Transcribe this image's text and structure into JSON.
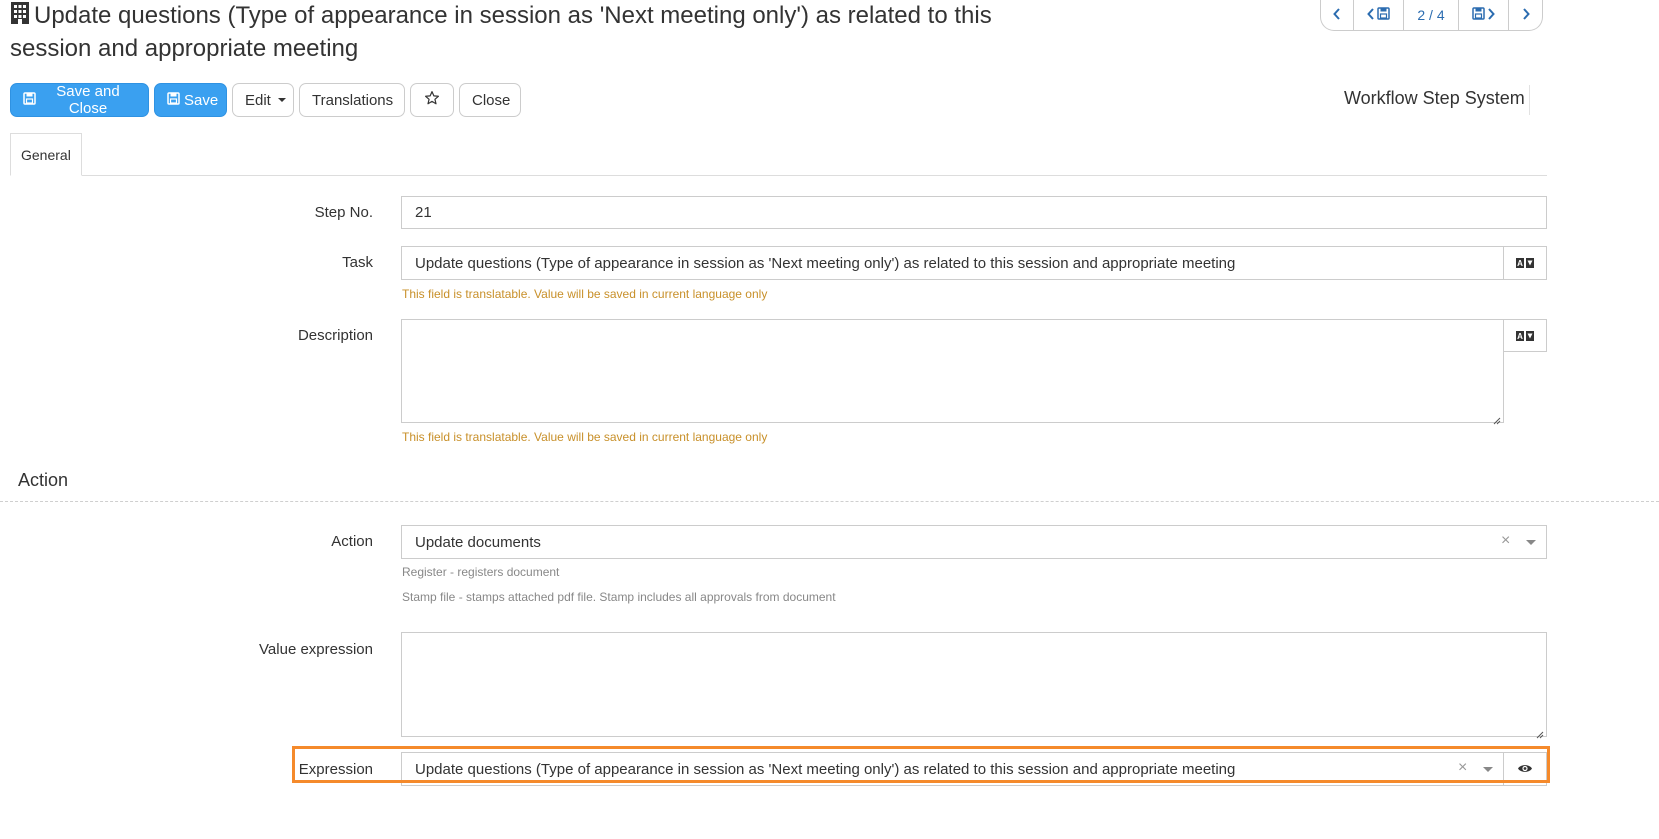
{
  "header": {
    "title": "Update questions (Type of appearance in session as 'Next meeting only') as related to this session and appropriate meeting",
    "title_icon": "building-icon"
  },
  "pager": {
    "position": "2 / 4"
  },
  "toolbar": {
    "save_close_label": "Save and Close",
    "save_label": "Save",
    "edit_label": "Edit",
    "translations_label": "Translations",
    "close_label": "Close"
  },
  "context": {
    "label": "Workflow Step System"
  },
  "tabs": [
    {
      "label": "General",
      "active": true
    }
  ],
  "form": {
    "step_no": {
      "label": "Step No.",
      "value": "21"
    },
    "task": {
      "label": "Task",
      "value": "Update questions (Type of appearance in session as 'Next meeting only') as related to this session and appropriate meeting",
      "hint": "This field is translatable. Value will be saved in current language only"
    },
    "description": {
      "label": "Description",
      "value": "",
      "hint": "This field is translatable. Value will be saved in current language only"
    },
    "section_action": "Action",
    "action": {
      "label": "Action",
      "value": "Update documents",
      "hint1": "Register - registers document",
      "hint2": "Stamp file - stamps attached pdf file. Stamp includes all approvals from document"
    },
    "value_expression": {
      "label": "Value expression",
      "value": ""
    },
    "expression": {
      "label": "Expression",
      "value": "Update questions (Type of appearance in session as 'Next meeting only') as related to this session and appropriate meeting"
    }
  },
  "colors": {
    "primary": "#3aa0f0",
    "link": "#2b6cb0",
    "warn_hint": "#c8902a",
    "highlight": "#f58a2b"
  }
}
